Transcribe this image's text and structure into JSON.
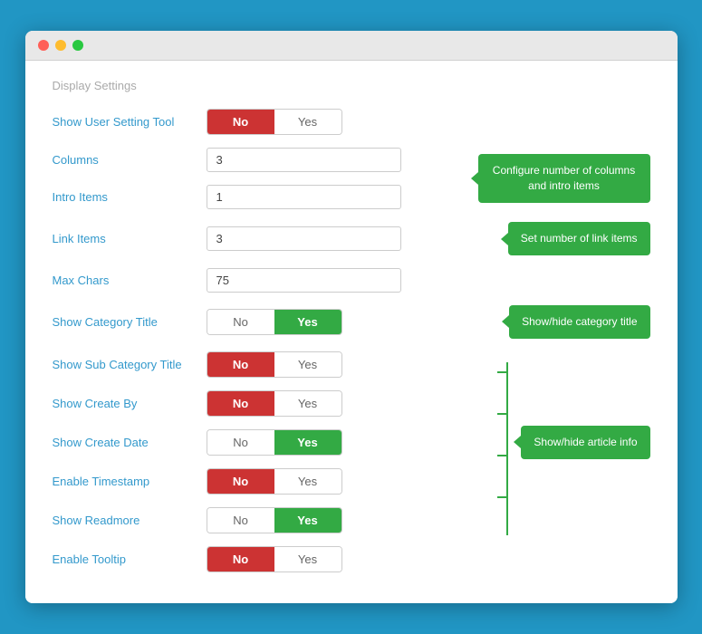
{
  "window": {
    "section_title": "Display Settings"
  },
  "rows": {
    "show_user_setting": {
      "label": "Show User Setting Tool",
      "no": "No",
      "yes": "Yes",
      "state": "no"
    },
    "columns": {
      "label": "Columns",
      "value": "3"
    },
    "intro_items": {
      "label": "Intro Items",
      "value": "1"
    },
    "link_items": {
      "label": "Link Items",
      "value": "3"
    },
    "max_chars": {
      "label": "Max Chars",
      "value": "75"
    },
    "show_category_title": {
      "label": "Show Category Title",
      "no": "No",
      "yes": "Yes",
      "state": "yes"
    },
    "show_sub_category": {
      "label": "Show Sub Category Title",
      "no": "No",
      "yes": "Yes",
      "state": "no"
    },
    "show_create_by": {
      "label": "Show Create By",
      "no": "No",
      "yes": "Yes",
      "state": "no"
    },
    "show_create_date": {
      "label": "Show Create Date",
      "no": "No",
      "yes": "Yes",
      "state": "yes"
    },
    "enable_timestamp": {
      "label": "Enable Timestamp",
      "no": "No",
      "yes": "Yes",
      "state": "no"
    },
    "show_readmore": {
      "label": "Show Readmore",
      "no": "No",
      "yes": "Yes",
      "state": "yes"
    },
    "enable_tooltip": {
      "label": "Enable Tooltip",
      "no": "No",
      "yes": "Yes",
      "state": "no"
    }
  },
  "callouts": {
    "columns_intro": "Configure number of columns and intro items",
    "link_items": "Set number of link items",
    "category_title": "Show/hide category title",
    "article_info": "Show/hide article info"
  }
}
